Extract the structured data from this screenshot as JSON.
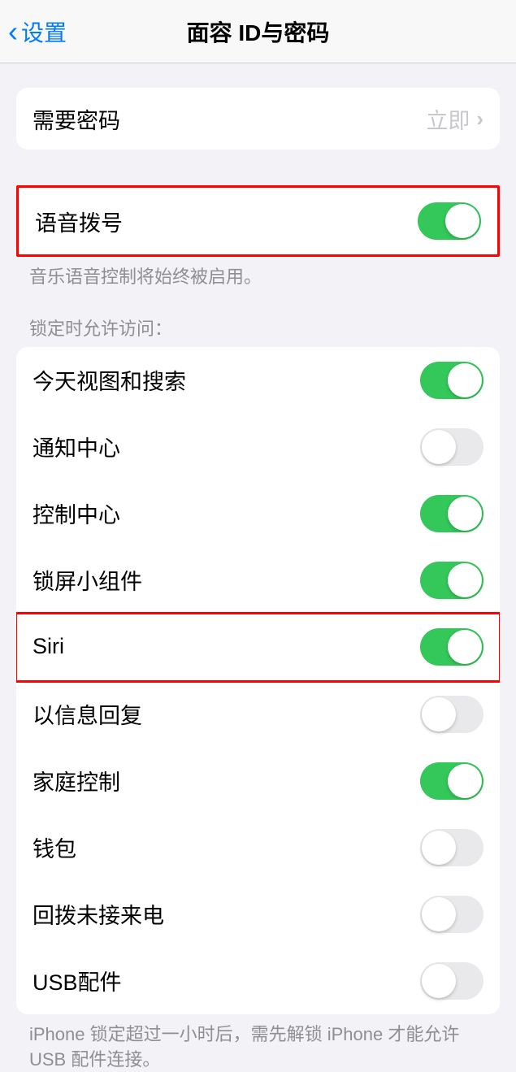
{
  "nav": {
    "back": "设置",
    "title": "面容 ID与密码"
  },
  "passcode_row": {
    "label": "需要密码",
    "value": "立即"
  },
  "voice_dial": {
    "label": "语音拨号",
    "on": true,
    "footer": "音乐语音控制将始终被启用。"
  },
  "lock_header": "锁定时允许访问：",
  "lock_items": [
    {
      "label": "今天视图和搜索",
      "on": true,
      "highlight": false
    },
    {
      "label": "通知中心",
      "on": false,
      "highlight": false
    },
    {
      "label": "控制中心",
      "on": true,
      "highlight": false
    },
    {
      "label": "锁屏小组件",
      "on": true,
      "highlight": false
    },
    {
      "label": "Siri",
      "on": true,
      "highlight": true
    },
    {
      "label": "以信息回复",
      "on": false,
      "highlight": false
    },
    {
      "label": "家庭控制",
      "on": true,
      "highlight": false
    },
    {
      "label": "钱包",
      "on": false,
      "highlight": false
    },
    {
      "label": "回拨未接来电",
      "on": false,
      "highlight": false
    },
    {
      "label": "USB配件",
      "on": false,
      "highlight": false
    }
  ],
  "lock_footer": "iPhone 锁定超过一小时后，需先解锁 iPhone 才能允许 USB 配件连接。"
}
